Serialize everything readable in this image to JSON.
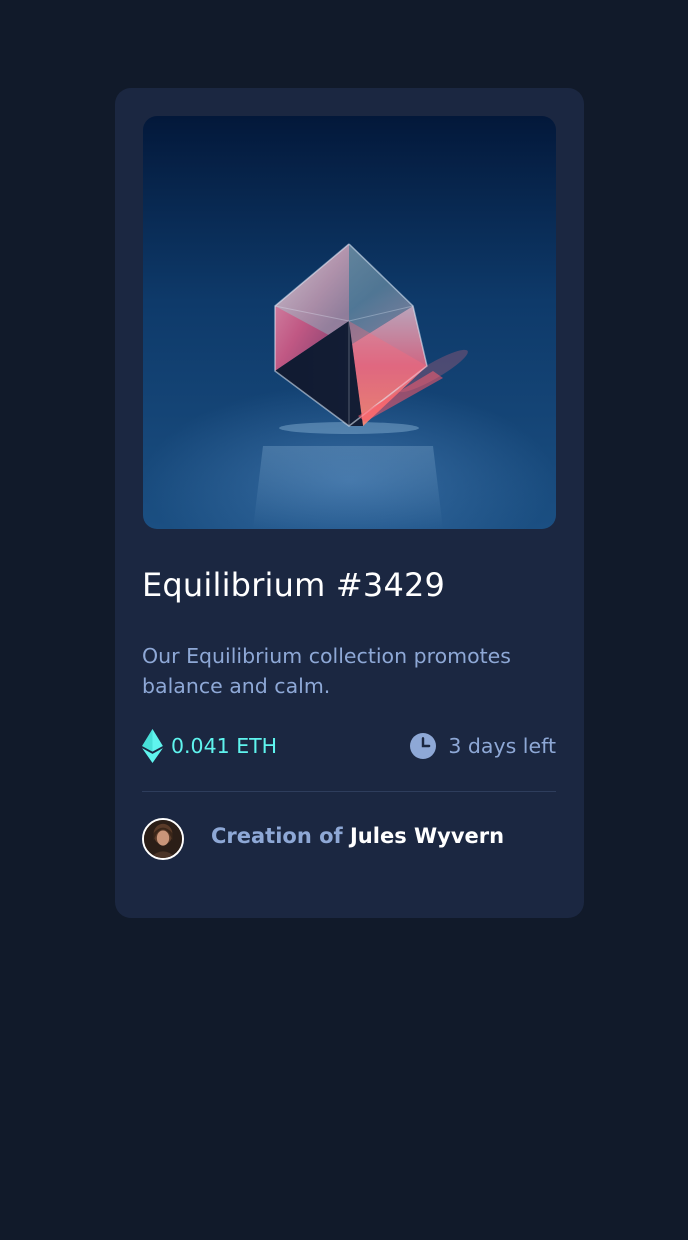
{
  "card": {
    "title": "Equilibrium #3429",
    "description": "Our Equilibrium collection promotes balance and calm.",
    "price": "0.041 ETH",
    "time_left": "3 days left",
    "creator_prefix": "Creation of ",
    "creator_name": "Jules Wyvern"
  },
  "icons": {
    "price": "ethereum-icon",
    "time": "clock-icon"
  },
  "colors": {
    "page_background": "#111a2a",
    "card_background": "#1b2741",
    "accent_cyan": "#5ff4ee",
    "soft_blue": "#8ea8d6",
    "white": "#ffffff",
    "divider": "#2e3d5c"
  }
}
